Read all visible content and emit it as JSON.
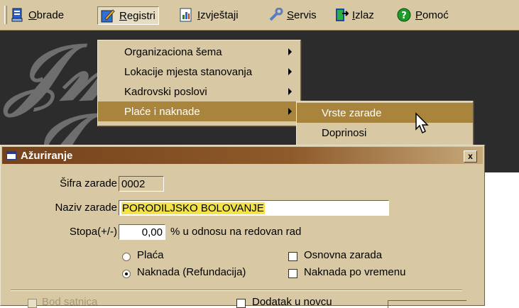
{
  "menubar": {
    "items": [
      {
        "label": "Obrade",
        "icon": "book-icon"
      },
      {
        "label": "Registri",
        "icon": "pencil-icon"
      },
      {
        "label": "Izvještaji",
        "icon": "report-icon"
      },
      {
        "label": "Servis",
        "icon": "wrench-icon"
      },
      {
        "label": "Izlaz",
        "icon": "exit-door-icon"
      },
      {
        "label": "Pomoć",
        "icon": "help-icon"
      }
    ]
  },
  "registri_menu": {
    "items": [
      {
        "label": "Organizaciona šema",
        "submenu": true
      },
      {
        "label": "Lokacije mjesta stanovanja",
        "submenu": true
      },
      {
        "label": "Kadrovski poslovi",
        "submenu": true
      },
      {
        "label": "Plaće i naknade",
        "submenu": true,
        "selected": true
      }
    ]
  },
  "submenu": {
    "items": [
      {
        "label": "Vrste zarade",
        "selected": true
      },
      {
        "label": "Doprinosi"
      }
    ]
  },
  "dialog": {
    "title": "Ažuriranje",
    "close_label": "x",
    "sifra_label": "Šifra zarade",
    "sifra_value": "0002",
    "naziv_label": "Naziv zarade",
    "naziv_value": "PORODILJSKO BOLOVANJE",
    "stopa_label": "Stopa(+/-)",
    "stopa_value": "0,00",
    "stopa_suffix": "% u odnosu na redovan rad",
    "radio_placa": "Plaća",
    "radio_naknada": "Naknada (Refundacija)",
    "selected_radio": "Naknada (Refundacija)",
    "check_osnovna": "Osnovna zarada",
    "check_naknada_vrijeme": "Naknada po vremenu",
    "check_bod": "Bod satnica",
    "check_dodatak": "Dodatak u novcu"
  },
  "colors": {
    "menu_bg": "#d8c9a4",
    "selection": "#a8843d",
    "titlebar": "#74421c",
    "field_highlight": "#f3e24a"
  }
}
